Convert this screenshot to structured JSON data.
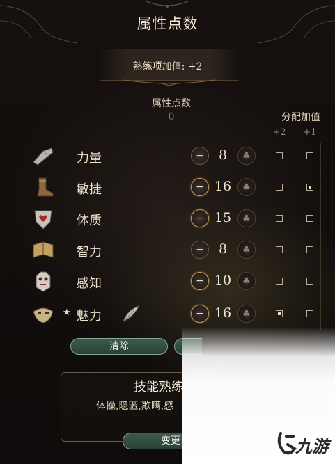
{
  "title": "属性点数",
  "bonus": {
    "text": "熟练项加值: +2"
  },
  "points": {
    "label": "属性点数",
    "value": "0"
  },
  "allocation": {
    "label": "分配加值",
    "col_plus2": "+2",
    "col_plus1": "+1"
  },
  "plus_glyph": "♣",
  "minus_glyph": "−",
  "star_glyph": "★",
  "abilities": [
    {
      "name": "力量",
      "value": "8",
      "icon": "gauntlet-icon",
      "minus_active": false,
      "plus2": false,
      "plus1": false
    },
    {
      "name": "敏捷",
      "value": "16",
      "icon": "boot-icon",
      "minus_active": true,
      "plus2": false,
      "plus1": true
    },
    {
      "name": "体质",
      "value": "15",
      "icon": "heart-shield-icon",
      "minus_active": true,
      "plus2": false,
      "plus1": false
    },
    {
      "name": "智力",
      "value": "8",
      "icon": "book-icon",
      "minus_active": false,
      "plus2": false,
      "plus1": false
    },
    {
      "name": "感知",
      "value": "10",
      "icon": "owl-icon",
      "minus_active": true,
      "plus2": false,
      "plus1": false
    },
    {
      "name": "魅力",
      "value": "16",
      "icon": "mask-icon",
      "minus_active": true,
      "plus2": true,
      "plus1": false,
      "starred": true
    }
  ],
  "buttons": {
    "clear": "清除",
    "change": "变更"
  },
  "skills": {
    "title": "技能熟练",
    "list": "体操,隐匿,欺瞒,感"
  },
  "watermark": {
    "text": "九游"
  }
}
